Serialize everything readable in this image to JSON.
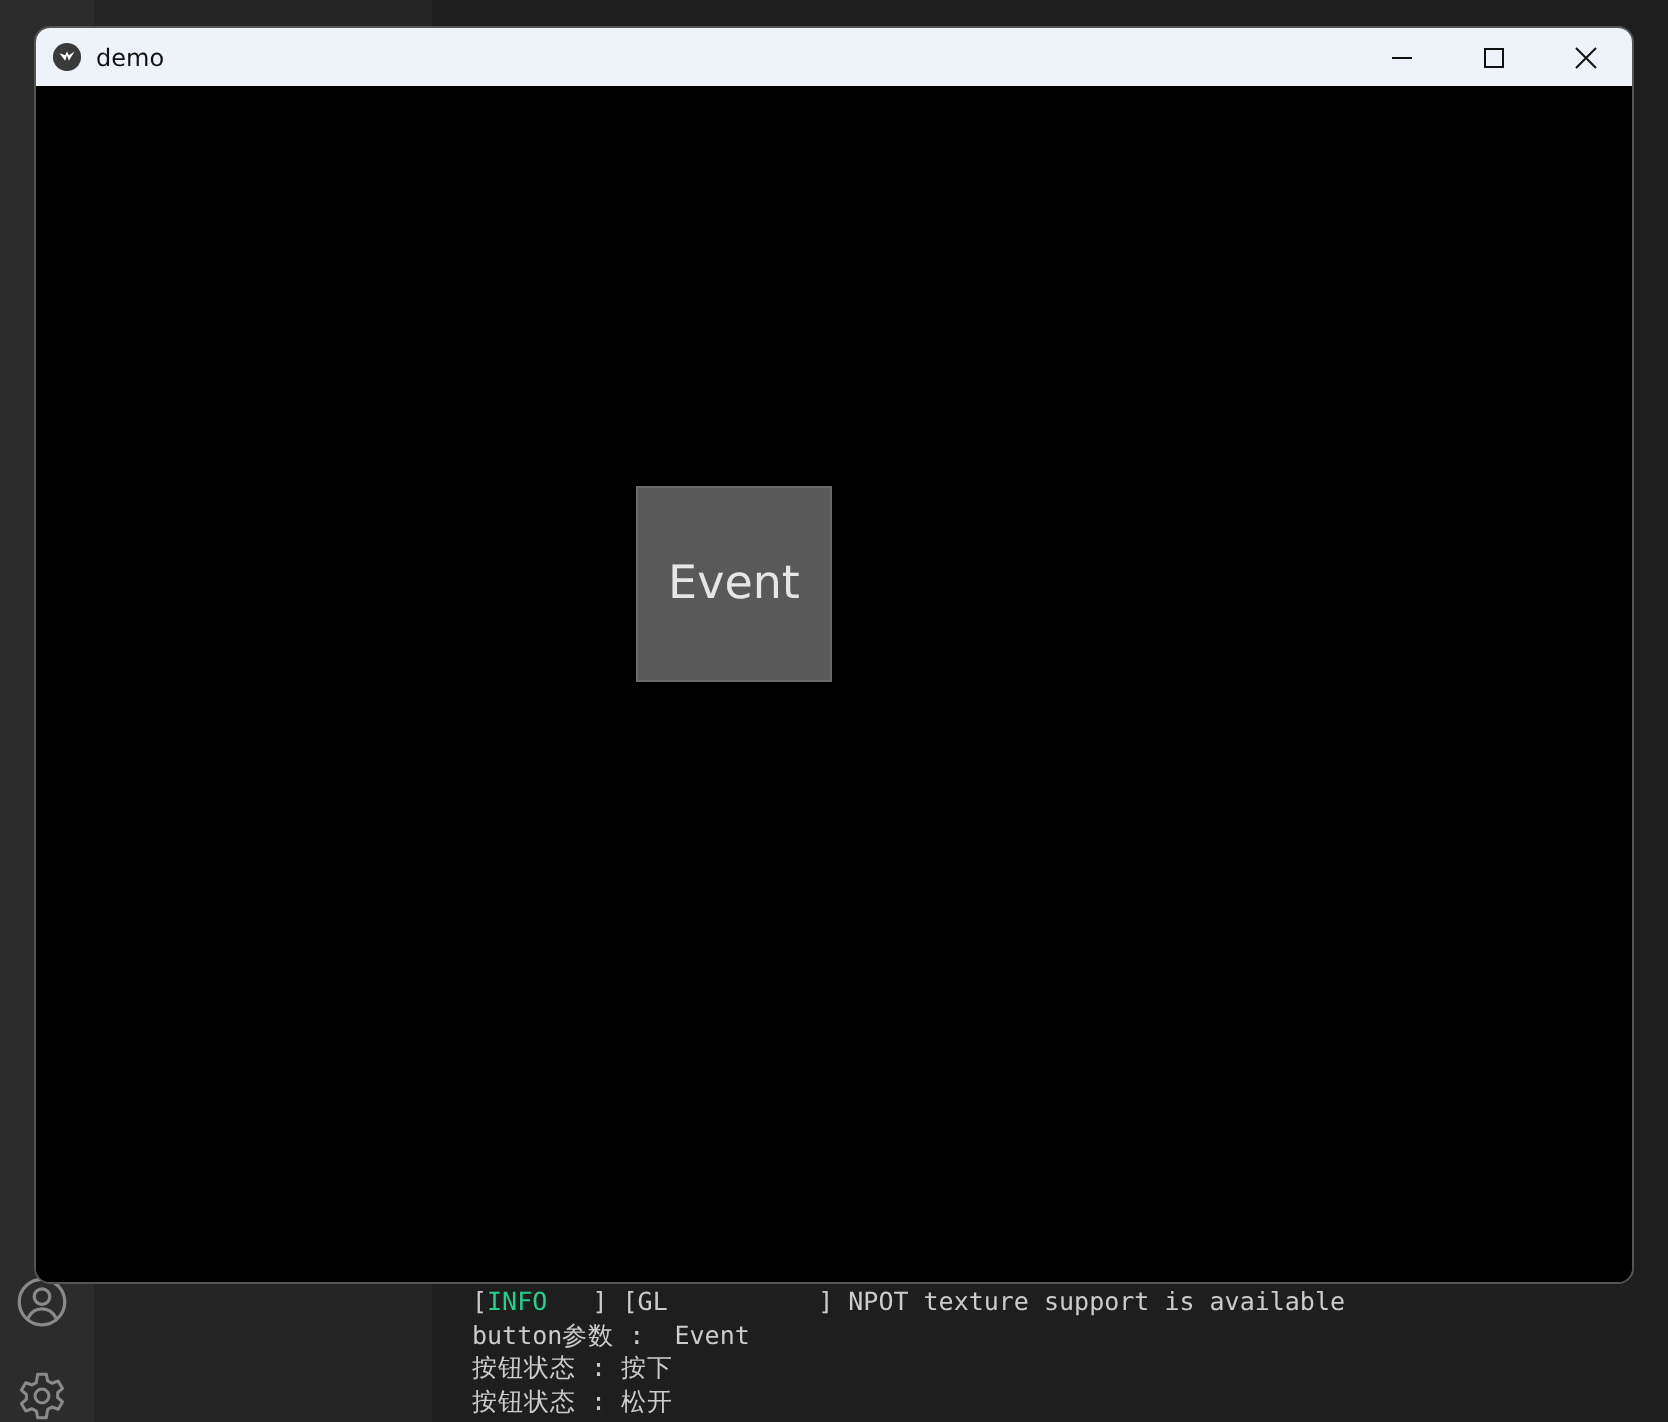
{
  "window": {
    "title": "demo",
    "button": {
      "label": "Event"
    }
  },
  "terminal": {
    "lines": [
      {
        "kind": "log",
        "tag": "INFO",
        "text_before": "[",
        "text_after": "   ] [GL          ] NPOT texture support is available"
      },
      {
        "kind": "plain",
        "text": "button参数 :  Event"
      },
      {
        "kind": "plain",
        "text": "按钮状态 : 按下"
      },
      {
        "kind": "plain",
        "text": "按钮状态 : 松开"
      }
    ]
  }
}
